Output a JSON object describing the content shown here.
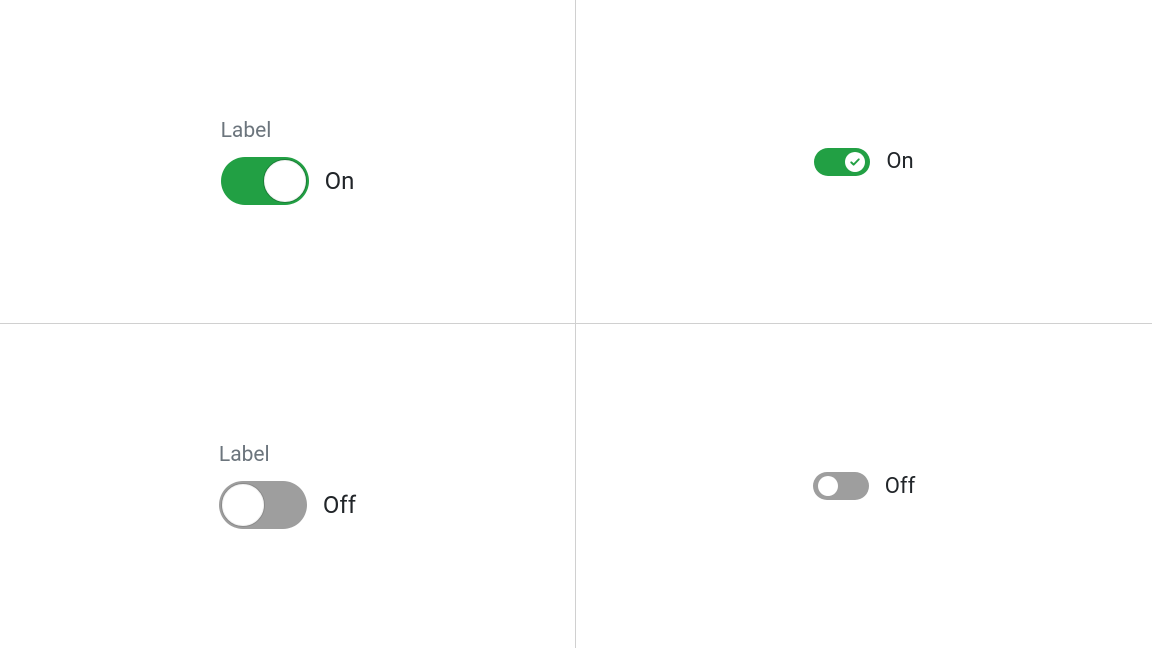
{
  "colors": {
    "on": "#22a044",
    "off": "#9e9e9e",
    "text": "#212529",
    "muted": "#6c757d"
  },
  "cells": {
    "topLeft": {
      "label": "Label",
      "state": "On"
    },
    "topRight": {
      "state": "On"
    },
    "bottomLeft": {
      "label": "Label",
      "state": "Off"
    },
    "bottomRight": {
      "state": "Off"
    }
  }
}
